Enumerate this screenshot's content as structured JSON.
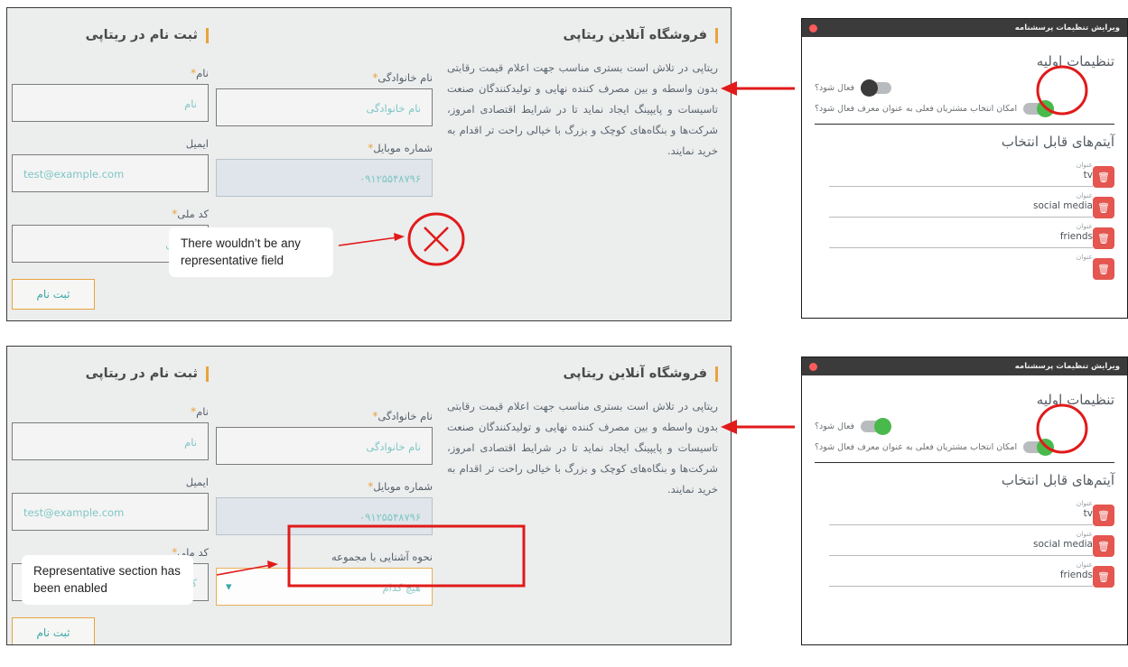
{
  "form": {
    "register_section_title": "ثبت نام در ریتاپی",
    "about_section_title": "فروشگاه آنلاین ریتاپی",
    "about_text": "ریتاپی در تلاش است بستری مناسب جهت اعلام قیمت رقابتی بدون واسطه و بین مصرف کننده نهایی و تولیدکنندگان صنعت تاسیسات و پایپینگ ایجاد نماید تا در شرایط اقتصادی امروز، شرکت‌ها و بنگاه‌های کوچک و بزرگ با خیالی راحت تر اقدام به خرید نمایند.",
    "fields": {
      "first_name": {
        "label": "نام",
        "required": "*",
        "placeholder": "نام"
      },
      "last_name": {
        "label": "نام خانوادگی",
        "required": "*",
        "placeholder": "نام خانوادگی"
      },
      "email": {
        "label": "ایمیل",
        "required": "",
        "placeholder": "test@example.com"
      },
      "mobile": {
        "label": "شماره موبایل",
        "required": "*",
        "placeholder": "۰۹۱۲۵۵۴۸۷۹۶"
      },
      "national_code": {
        "label": "کد ملی",
        "required": "*",
        "placeholder": "کد ملی"
      },
      "referral": {
        "label": "نحوه آشنایی با مجموعه",
        "required": "",
        "value": "هیچ کدام",
        "chevron": "chevron-down-icon"
      }
    },
    "submit_label": "ثبت نام"
  },
  "settings": {
    "window_title": "ویرایش تنظیمات پرسشنامه",
    "initial_settings_heading": "تنظیمات اولیه",
    "items_heading": "آیتم‌های قابل انتخاب",
    "toggles": {
      "enable_label": "فعال شود؟",
      "existing_customers_label": "امکان انتخاب مشتریان فعلی به عنوان معرف فعال شود؟"
    },
    "item_field_label": "عنوان",
    "items_top": [
      "tv",
      "social media",
      "friends",
      "عنوان"
    ],
    "items_bottom": [
      "tv",
      "social media",
      "friends"
    ],
    "delete_icon": "trash-icon",
    "states": {
      "top_enable": "off",
      "top_existing": "on",
      "bottom_enable": "on",
      "bottom_existing": "on"
    }
  },
  "annotations": {
    "top_note": "There wouldn’t be any representative field",
    "bottom_note": "Representative section has been enabled"
  },
  "colors": {
    "accent_orange": "#e8a33d",
    "teal_placeholder": "#7fc6c6",
    "annotation_red": "#e11a1a",
    "toggle_green": "#49b94c",
    "danger_red": "#e4564f",
    "titlebar_dark": "#3b3b3b"
  }
}
